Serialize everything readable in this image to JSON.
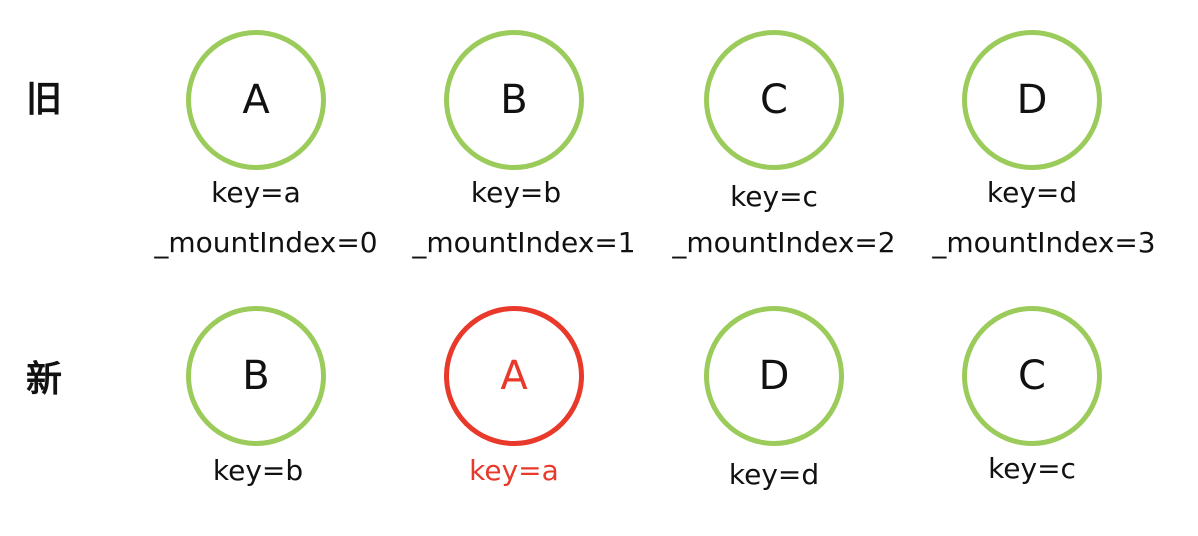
{
  "colors": {
    "normal_stroke": "#9bcb5a",
    "highlight_stroke": "#e8392b",
    "text": "#111111",
    "highlight_text": "#e8392b"
  },
  "old": {
    "label": "旧",
    "nodes": [
      {
        "letter": "A",
        "key": "key=a",
        "mount_index": "_mountIndex=0"
      },
      {
        "letter": "B",
        "key": "key=b",
        "mount_index": "_mountIndex=1"
      },
      {
        "letter": "C",
        "key": "key=c",
        "mount_index": "_mountIndex=2"
      },
      {
        "letter": "D",
        "key": "key=d",
        "mount_index": "_mountIndex=3"
      }
    ]
  },
  "new": {
    "label": "新",
    "nodes": [
      {
        "letter": "B",
        "key": "key=b",
        "highlight": false
      },
      {
        "letter": "A",
        "key": "key=a",
        "highlight": true
      },
      {
        "letter": "D",
        "key": "key=d",
        "highlight": false
      },
      {
        "letter": "C",
        "key": "key=c",
        "highlight": false
      }
    ]
  }
}
